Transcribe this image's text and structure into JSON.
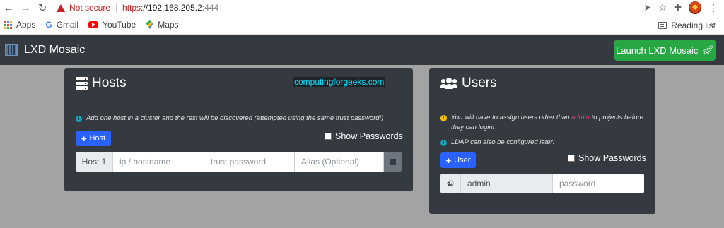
{
  "browser": {
    "security_label": "Not secure",
    "url_proto": "https",
    "url_host": "://192.168.205.2",
    "url_port": ":444",
    "bookmarks": [
      {
        "label": "Apps",
        "icon": "apps-grid-icon"
      },
      {
        "label": "Gmail",
        "icon": "google-icon"
      },
      {
        "label": "YouTube",
        "icon": "youtube-icon"
      },
      {
        "label": "Maps",
        "icon": "maps-icon"
      }
    ],
    "reading_list": "Reading list",
    "colors": {
      "warning": "#c5221f"
    }
  },
  "app": {
    "title": "LXD Mosaic",
    "launch_label": "Launch LXD Mosaic",
    "colors": {
      "navbar": "#343a40",
      "launch": "#28a745",
      "primary": "#2962ff"
    }
  },
  "hosts": {
    "title": "Hosts",
    "watermark": "computingforgeeks.com",
    "note": "Add one host in a cluster and the rest will be discovered (attempted using the same trust password!)",
    "add_label": "Host",
    "show_passwords": "Show Passwords",
    "row": {
      "prefix": "Host 1",
      "ip_placeholder": "ip / hostname",
      "trust_placeholder": "trust password",
      "alias_placeholder": "Alias (Optional)"
    }
  },
  "users": {
    "title": "Users",
    "note1_pre": "You will have to assign users other than",
    "note1_hl": "admin",
    "note1_post": "to projects before they can login!",
    "note2": "LDAP can also be configured later!",
    "add_label": "User",
    "show_passwords": "Show Passwords",
    "row": {
      "username": "admin",
      "password_placeholder": "password"
    }
  }
}
